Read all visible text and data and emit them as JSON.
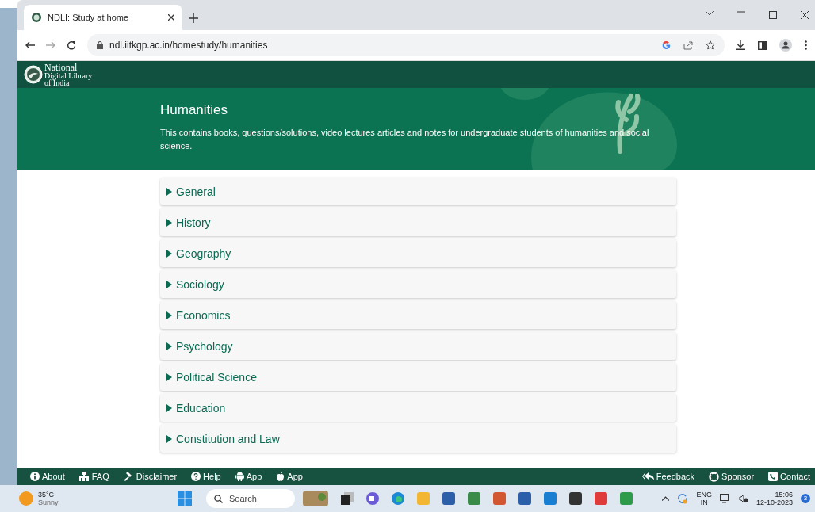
{
  "browser": {
    "tab_title": "NDLI: Study at home",
    "url": "ndl.iitkgp.ac.in/homestudy/humanities"
  },
  "site": {
    "logo_lines": [
      "National",
      "Digital Library",
      "of India"
    ]
  },
  "hero": {
    "title": "Humanities",
    "description": "This contains books, questions/solutions, video lectures articles and notes for undergraduate students of humanities and social science."
  },
  "sections": [
    {
      "label": "General",
      "expanded": false
    },
    {
      "label": "History",
      "expanded": false
    },
    {
      "label": "Geography",
      "expanded": false
    },
    {
      "label": "Sociology",
      "expanded": false
    },
    {
      "label": "Economics",
      "expanded": false
    },
    {
      "label": "Psychology",
      "expanded": false
    },
    {
      "label": "Political Science",
      "expanded": false
    },
    {
      "label": "Education",
      "expanded": false
    },
    {
      "label": "Constitution and Law",
      "expanded": false
    }
  ],
  "footer": {
    "left_links": [
      {
        "label": "About"
      },
      {
        "label": "FAQ"
      },
      {
        "label": "Disclaimer"
      },
      {
        "label": "Help"
      },
      {
        "label": "App"
      },
      {
        "label": "App"
      }
    ],
    "right_links": [
      {
        "label": "Feedback"
      },
      {
        "label": "Sponsor"
      },
      {
        "label": "Contact"
      }
    ]
  },
  "taskbar": {
    "temperature": "35°C",
    "weather": "Sunny",
    "search_placeholder": "Search",
    "language": "ENG",
    "region": "IN",
    "time": "15:06",
    "date": "12-10-2023",
    "notification_count": "3"
  }
}
